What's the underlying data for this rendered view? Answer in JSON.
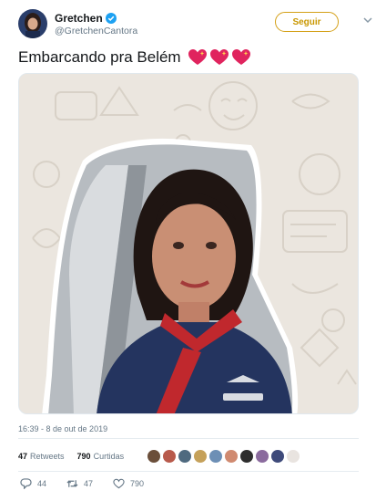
{
  "user": {
    "name": "Gretchen",
    "handle": "@GretchenCantora",
    "verified_icon": "verified-badge-icon"
  },
  "follow_button": {
    "label": "Seguir"
  },
  "tweet": {
    "text": "Embarcando pra Belém",
    "emoji_icons": [
      "sparkling-heart-icon",
      "sparkling-heart-icon",
      "sparkling-heart-icon"
    ]
  },
  "timestamp": "16:39 - 8 de out de 2019",
  "stats": {
    "retweets_count": "47",
    "retweets_label": "Retweets",
    "likes_count": "790",
    "likes_label": "Curtidas"
  },
  "actions": {
    "reply_count": "44",
    "retweet_count": "47",
    "like_count": "790"
  },
  "colors": {
    "accent": "#1da1f2",
    "follow": "#c99700",
    "muted": "#657786"
  }
}
